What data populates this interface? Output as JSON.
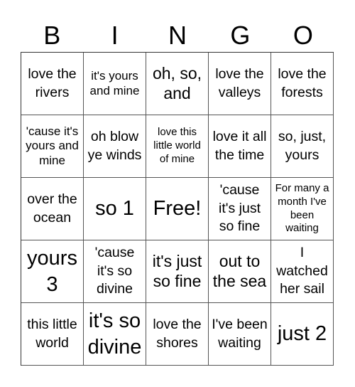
{
  "header": [
    "B",
    "I",
    "N",
    "G",
    "O"
  ],
  "cells": [
    {
      "text": "love the rivers",
      "size": "s3"
    },
    {
      "text": "it's yours and mine",
      "size": "s2"
    },
    {
      "text": "oh, so, and",
      "size": "s4"
    },
    {
      "text": "love the valleys",
      "size": "s3"
    },
    {
      "text": "love the forests",
      "size": "s3"
    },
    {
      "text": "'cause it's yours and mine",
      "size": "s2"
    },
    {
      "text": "oh blow ye winds",
      "size": "s3"
    },
    {
      "text": "love this little world of mine",
      "size": "s1"
    },
    {
      "text": "love it all the time",
      "size": "s3"
    },
    {
      "text": "so, just, yours",
      "size": "s3"
    },
    {
      "text": "over the ocean",
      "size": "s3"
    },
    {
      "text": "so 1",
      "size": "s5"
    },
    {
      "text": "Free!",
      "size": "s5"
    },
    {
      "text": "'cause it's just so fine",
      "size": "s3"
    },
    {
      "text": "For many a month I've been waiting",
      "size": "s1"
    },
    {
      "text": "yours 3",
      "size": "s5"
    },
    {
      "text": "'cause it's so divine",
      "size": "s3"
    },
    {
      "text": "it's just so fine",
      "size": "s4"
    },
    {
      "text": "out to the sea",
      "size": "s4"
    },
    {
      "text": "I watched her sail",
      "size": "s3"
    },
    {
      "text": "this little world",
      "size": "s3"
    },
    {
      "text": "it's so divine",
      "size": "s5"
    },
    {
      "text": "love the shores",
      "size": "s3"
    },
    {
      "text": "I've been waiting",
      "size": "s3"
    },
    {
      "text": "just 2",
      "size": "s5"
    }
  ]
}
